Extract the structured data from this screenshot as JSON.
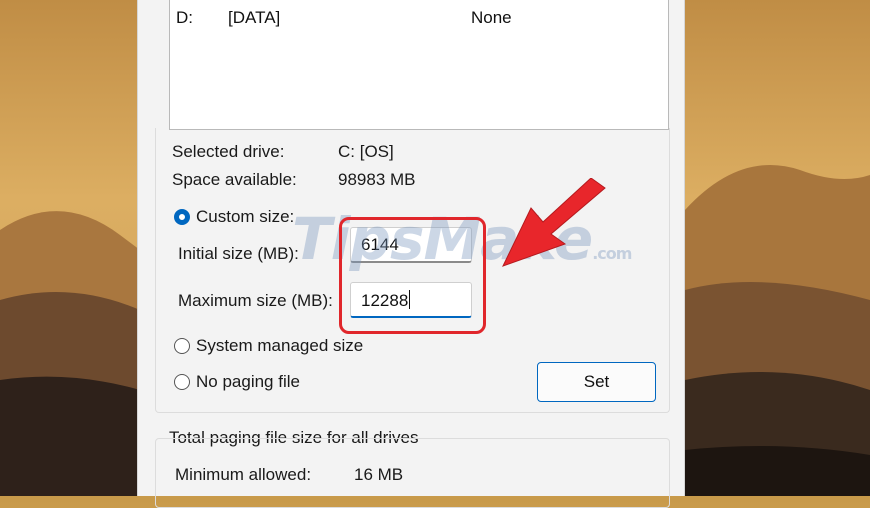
{
  "drive_list": {
    "row": {
      "drive": "D:",
      "label": "[DATA]",
      "paging_size": "None"
    }
  },
  "selected_drive": {
    "label": "Selected drive:",
    "value": "C:  [OS]"
  },
  "space_available": {
    "label": "Space available:",
    "value": "98983 MB"
  },
  "options": {
    "custom_size": "Custom size:",
    "initial_size_label": "Initial size (MB):",
    "initial_size_value": "6144",
    "maximum_size_label": "Maximum size (MB):",
    "maximum_size_value": "12288",
    "system_managed": "System managed size",
    "no_paging": "No paging file",
    "selected": "custom_size"
  },
  "set_button": "Set",
  "totals": {
    "title": "Total paging file size for all drives",
    "minimum_label": "Minimum allowed:",
    "minimum_value": "16 MB"
  },
  "watermark": {
    "brand": "TipsMake",
    "suffix": ".com"
  },
  "colors": {
    "accent": "#0067c0",
    "highlight": "#e0262b"
  }
}
